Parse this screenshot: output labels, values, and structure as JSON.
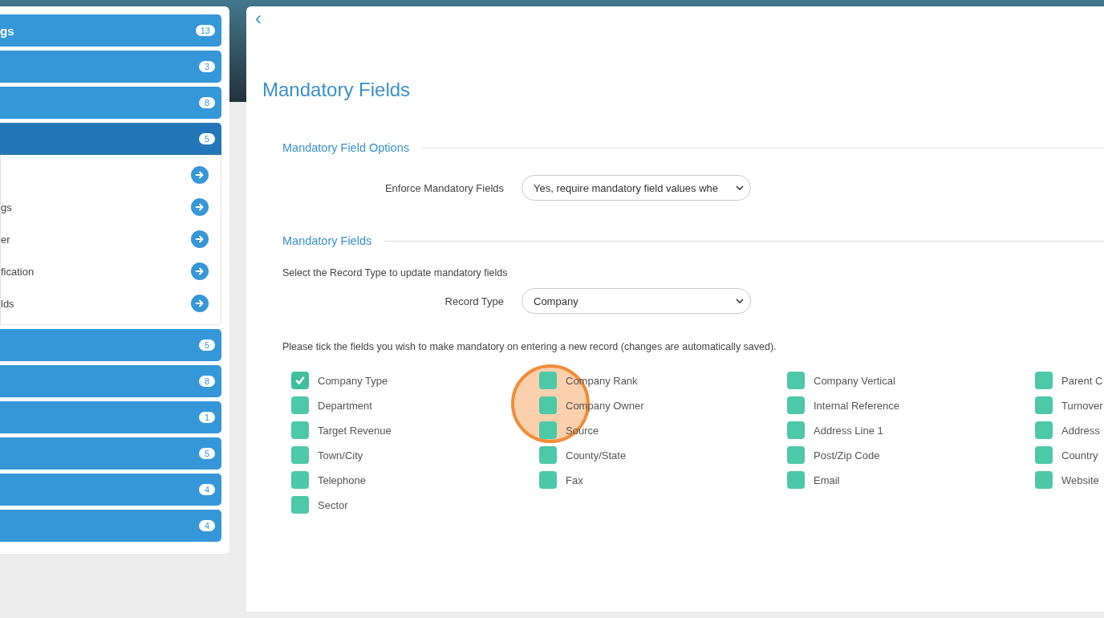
{
  "sidebar": {
    "groups": [
      {
        "label": "gs",
        "count": "13",
        "expanded": false
      },
      {
        "count": "3",
        "expanded": false
      },
      {
        "count": "8",
        "expanded": false
      },
      {
        "count": "5",
        "expanded": true,
        "children": [
          {
            "kind": "blank"
          },
          {
            "kind": "text",
            "label": "gs"
          },
          {
            "kind": "text",
            "label": "er"
          },
          {
            "kind": "text",
            "label": "fication"
          },
          {
            "kind": "text",
            "label": "lds"
          }
        ]
      },
      {
        "count": "5",
        "expanded": false
      },
      {
        "count": "8",
        "expanded": false
      },
      {
        "count": "1",
        "expanded": false
      },
      {
        "count": "5",
        "expanded": false
      },
      {
        "count": "4",
        "expanded": false
      },
      {
        "count": "4",
        "expanded": false
      }
    ]
  },
  "main": {
    "back": "‹",
    "title": "Mandatory Fields",
    "options": {
      "heading": "Mandatory Field Options",
      "label": "Enforce Mandatory Fields",
      "value": "Yes, require mandatory field values whe"
    },
    "fields_section": {
      "heading": "Mandatory Fields",
      "hint": "Select the Record Type to update mandatory fields",
      "label": "Record Type",
      "value": "Company",
      "instruction": "Please tick the fields you wish to make mandatory on entering a new record (changes are automatically saved).",
      "fields": [
        {
          "label": "Company Type",
          "checked": true
        },
        {
          "label": "Company Rank",
          "checked": false
        },
        {
          "label": "Company Vertical",
          "checked": false
        },
        {
          "label": "Parent C",
          "checked": false
        },
        {
          "label": "Department",
          "checked": false
        },
        {
          "label": "Company Owner",
          "checked": false
        },
        {
          "label": "Internal Reference",
          "checked": false
        },
        {
          "label": "Turnover",
          "checked": false
        },
        {
          "label": "Target Revenue",
          "checked": false
        },
        {
          "label": "Source",
          "checked": false
        },
        {
          "label": "Address Line 1",
          "checked": false
        },
        {
          "label": "Address",
          "checked": false
        },
        {
          "label": "Town/City",
          "checked": false
        },
        {
          "label": "County/State",
          "checked": false
        },
        {
          "label": "Post/Zip Code",
          "checked": false
        },
        {
          "label": "Country",
          "checked": false
        },
        {
          "label": "Telephone",
          "checked": false
        },
        {
          "label": "Fax",
          "checked": false
        },
        {
          "label": "Email",
          "checked": false
        },
        {
          "label": "Website",
          "checked": false
        },
        {
          "label": "Sector",
          "checked": false
        }
      ]
    }
  }
}
